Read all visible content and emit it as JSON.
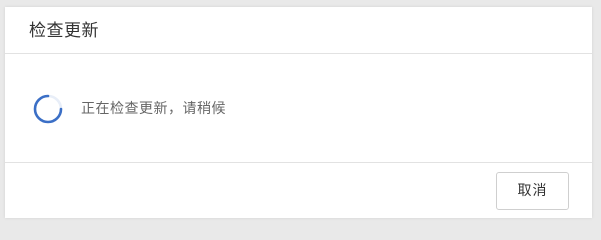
{
  "dialog": {
    "title": "检查更新",
    "status_text": "正在检查更新，请稍候",
    "spinner_icon": "loading-spinner-icon",
    "cancel_label": "取消"
  },
  "colors": {
    "spinner_accent": "#3b6fc6",
    "spinner_track": "#c9d8f0"
  }
}
